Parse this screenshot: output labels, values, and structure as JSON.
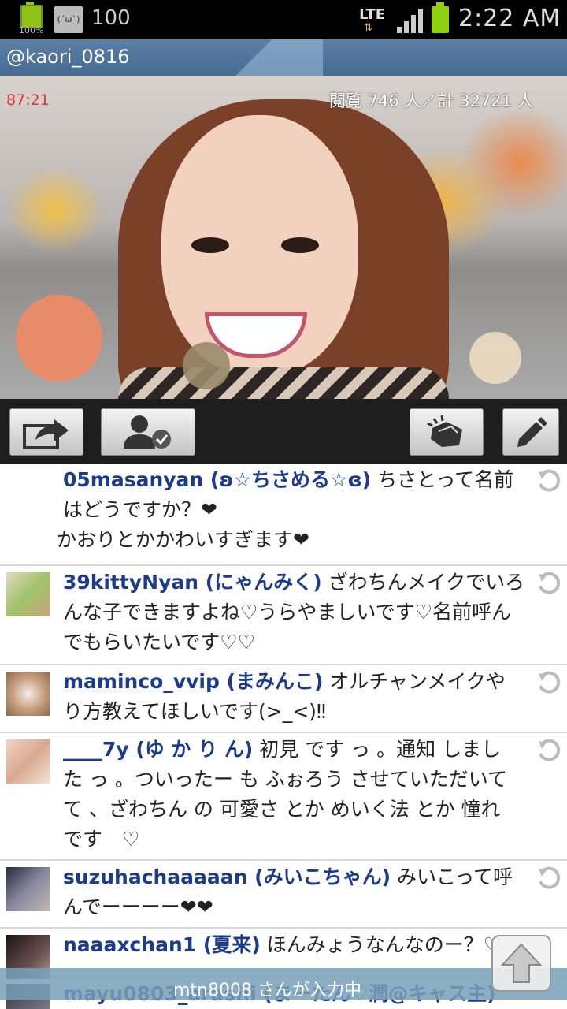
{
  "status_bar": {
    "battery_small_pct": "100%",
    "face_icon": "(´ω`)",
    "viewer_count": "100",
    "network": "LTE",
    "time": "2:22 AM"
  },
  "title_bar": {
    "handle": "@kaori_0816"
  },
  "video": {
    "timer": "87:21",
    "views": "閲覧 746 人／計 32721 人"
  },
  "toolbar": {
    "buttons": [
      "share-icon",
      "follow-user-icon",
      "clap-icon",
      "pencil-icon"
    ]
  },
  "comments": [
    {
      "user": "05masanyan (ʚ☆ちさめる☆ɞ)",
      "text": " ちさとって名前はどうですか？❤",
      "text2": "かおりとかかわいすぎます❤",
      "avatar_color": "#6a3f6e"
    },
    {
      "user": "39kittyNyan (にゃんみく)",
      "text": " ざわちんメイクでいろんな子できますよね♡うらやましいです♡名前呼んでもらいたいです♡♡",
      "avatar_color": "#b9d37a"
    },
    {
      "user": "maminco_vvip (まみんこ)",
      "text": " オルチャンメイクやり方教えてほしいです(>_<)‼",
      "avatar_color": "#b48a73"
    },
    {
      "user": "____7y (ゆ か り ん)",
      "text": " 初見 です っ 。通知 しました っ 。ついったー も ふぉろう させていただいてて 、ざわちん の 可愛さ とか めいく法 とか 憧れ です　♡",
      "avatar_color": "#e2b9a6"
    },
    {
      "user": "suzuhachaaaaan (みいこちゃん)",
      "text": " みいこって呼んでーーーー❤❤",
      "avatar_color": "#5a5a6e"
    },
    {
      "user": "naaaxchan1 (夏来)",
      "text": " ほんみょうなんなのー？♡",
      "avatar_color": "#3a3030"
    },
    {
      "user": "mayu0803_arashi (まーたん♡潤@キャス主)",
      "text": "",
      "avatar_color": "#4c4c5a"
    }
  ],
  "typing_indicator": "mtn8008 さんが入力中",
  "colors": {
    "title_bar": "#4f739a",
    "username": "#1c3b8a",
    "heart": "#e0432b"
  }
}
